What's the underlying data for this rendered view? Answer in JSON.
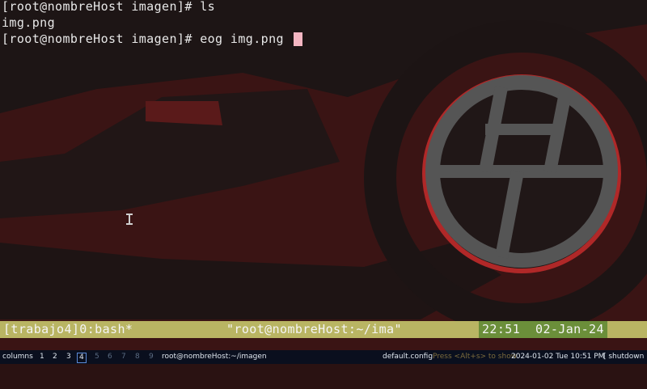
{
  "terminal": {
    "lines": [
      "[root@nombreHost imagen]# ls",
      "img.png",
      "[root@nombreHost imagen]# eog img.png "
    ]
  },
  "tmux_status": {
    "session": "[trabajo4]0:bash*",
    "title": "\"root@nombreHost:~/ima\"",
    "time": "22:51  02-Jan-24"
  },
  "panel": {
    "label": "columns",
    "workspaces": [
      "1",
      "2",
      "3",
      "4",
      "5",
      "6",
      "7",
      "8",
      "9"
    ],
    "active_workspace": "4",
    "window_title": "root@nombreHost:~/imagen",
    "config": "default.config",
    "hint": "Press <Alt+s> to show",
    "datetime": "2024-01-02 Tue 10:51 PM",
    "shutdown": "[ shutdown ]"
  },
  "colors": {
    "wallpaper_dark": "#1a1a1a",
    "wallpaper_red": "#4a1616",
    "tmux_bar": "#b9b563",
    "tmux_time": "#6b8f3a",
    "cursor": "#f4b6c2",
    "panel_bg": "#0a0f1e"
  }
}
